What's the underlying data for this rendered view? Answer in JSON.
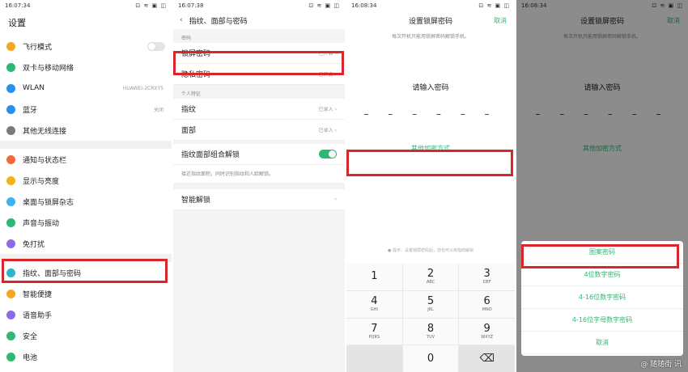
{
  "panel1": {
    "status_time": "16:07:34",
    "status_icons": "⊡ ≋ ▣ ◫",
    "title": "设置",
    "group1": [
      {
        "label": "飞行模式",
        "icon": "airplane-icon",
        "color": "#f5a623",
        "right": ""
      },
      {
        "label": "双卡与移动网络",
        "icon": "sim-icon",
        "color": "#2eb873",
        "right": ""
      },
      {
        "label": "WLAN",
        "icon": "wifi-icon",
        "color": "#2a8ef0",
        "right": "HUAWEI-2CRXY5"
      },
      {
        "label": "蓝牙",
        "icon": "bluetooth-icon",
        "color": "#2a8ef0",
        "right": "关闭"
      },
      {
        "label": "其他无线连接",
        "icon": "link-icon",
        "color": "#7a7a7a",
        "right": ""
      }
    ],
    "group2": [
      {
        "label": "通知与状态栏",
        "icon": "notification-icon",
        "color": "#f26a3a"
      },
      {
        "label": "显示与亮度",
        "icon": "brightness-icon",
        "color": "#f5b31b"
      },
      {
        "label": "桌面与锁屏杂志",
        "icon": "wallpaper-icon",
        "color": "#3fb0f2"
      },
      {
        "label": "声音与振动",
        "icon": "sound-icon",
        "color": "#2eb873"
      },
      {
        "label": "免打扰",
        "icon": "moon-icon",
        "color": "#8d6be8"
      }
    ],
    "group3": [
      {
        "label": "指纹、面部与密码",
        "icon": "fingerprint-icon",
        "color": "#30b5c8"
      },
      {
        "label": "智能便捷",
        "icon": "smart-icon",
        "color": "#f5a623"
      },
      {
        "label": "语音助手",
        "icon": "voice-icon",
        "color": "#8d6be8"
      },
      {
        "label": "安全",
        "icon": "shield-icon",
        "color": "#2eb873"
      },
      {
        "label": "电池",
        "icon": "battery-icon",
        "color": "#2eb873"
      }
    ]
  },
  "panel2": {
    "status_time": "16:07:38",
    "status_icons": "⊡ ≋ ▣ ◫",
    "title": "指纹、面部与密码",
    "section_password": "密码",
    "lock_password": "锁屏密码",
    "lock_password_state": "已开启",
    "privacy_password": "隐私密码",
    "privacy_password_state": "已开启",
    "section_personal": "个人特征",
    "fingerprint": "指纹",
    "fingerprint_state": "已录入",
    "face": "面部",
    "face_state": "已录入",
    "combo_unlock": "指纹面部组合解锁",
    "combo_note": "接近指纹面积，同时识别指纹和人脸解锁。",
    "smart_unlock": "智能解锁"
  },
  "panel3": {
    "status_time": "16:08:34",
    "status_icons": "⊡ ≋ ▣ ◫",
    "title": "设置锁屏密码",
    "cancel": "取消",
    "subtitle": "每次开机只能用锁屏密码解锁手机。",
    "prompt": "请输入密码",
    "dashes": "– – – – – –",
    "other_methods": "其他加密方式",
    "tip": "● 提示：设置锁屏密码后，您也可以用指纹解锁",
    "keys": [
      {
        "n": "1",
        "l": ""
      },
      {
        "n": "2",
        "l": "ABC"
      },
      {
        "n": "3",
        "l": "DEF"
      },
      {
        "n": "4",
        "l": "GHI"
      },
      {
        "n": "5",
        "l": "JKL"
      },
      {
        "n": "6",
        "l": "MNO"
      },
      {
        "n": "7",
        "l": "PQRS"
      },
      {
        "n": "8",
        "l": "TUV"
      },
      {
        "n": "9",
        "l": "WXYZ"
      },
      {
        "n": "",
        "l": ""
      },
      {
        "n": "0",
        "l": ""
      },
      {
        "n": "⌫",
        "l": ""
      }
    ]
  },
  "panel4": {
    "status_time": "16:08:34",
    "status_icons": "⊡ ≋ ▣ ◫",
    "title": "设置锁屏密码",
    "cancel": "取消",
    "subtitle": "每次开机只能用锁屏密码解锁手机。",
    "prompt": "请输入密码",
    "dashes": "– – – – – –",
    "other_methods": "其他加密方式",
    "options": [
      "图案密码",
      "4位数字密码",
      "4-16位数字密码",
      "4-16位字母数字密码",
      "取消"
    ],
    "watermark": "@ 随随街 讯"
  },
  "colors": {
    "accent": "#2eb873",
    "highlight": "#d9262b"
  }
}
